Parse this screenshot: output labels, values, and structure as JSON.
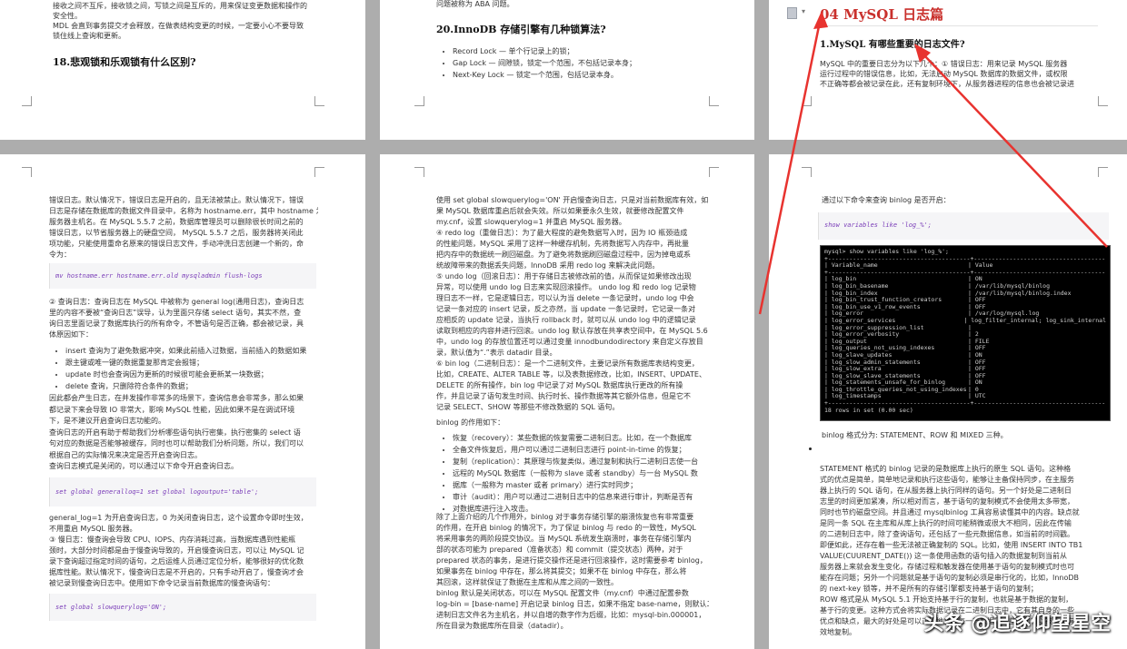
{
  "doc": {
    "p1": {
      "top_lines": [
        "接收之间不互斥，接收锁之间，写锁之间是互斥的，用来保证变更数据和操作的",
        "安全性。",
        "MDL 会直到事务提交才会释放，在做表结构变更的时候，一定要小心不要导致",
        "锁住线上查询和更新。"
      ],
      "heading": "18.悲观锁和乐观锁有什么区别?"
    },
    "p2": {
      "top_line": "问题被称为 ABA 问题。",
      "heading": "20.InnoDB 存储引擎有几种锁算法?",
      "bullets": [
        "Record Lock — 单个行记录上的锁；",
        "Gap Lock — 间隙锁，锁定一个范围，不包括记录本身；",
        "Next-Key Lock — 锁定一个范围，包括记录本身。"
      ]
    },
    "p3": {
      "title": "04 MySQL 日志篇",
      "heading": "1.MySQL 有哪些重要的日志文件?",
      "lines": [
        "MySQL 中的重要日志分为以下几个：① 错误日志：用来记录 MySQL 服务器",
        "运行过程中的错误信息，比如，无法启动 MySQL 数据库的数据文件，或权限",
        "不正确等都会被记录在此，还有复制环境下，从服务器进程的信息也会被记录进"
      ]
    },
    "p4": {
      "lines_a": [
        "错误日志。默认情况下，错误日志是开启的，且无法被禁止。默认情况下，错误",
        "日志是存储在数据库的数据文件目录中，名称为 hostname.err，其中 hostname 为",
        "服务器主机名。在 MySQL 5.5.7 之前，数据库管理员可以删除很长时间之前的",
        "错误日志，以节省服务器上的硬盘空间， MySQL 5.5.7 之后，服务器将关闭此",
        "项功能，只能使用重命名原来的错误日志文件，手动冲洗日志创建一个新的，命",
        "令为："
      ],
      "code1": "mv hostname.err  hostname.err.old mysqladmin flush-logs",
      "lines_b": [
        "② 查询日志：查询日志在 MySQL 中被称为 general log(通用日志)，查询日志",
        "里的内容不要被“查询日志”误导，认为里面只存储 select 语句，其实不然，查",
        "询日志里面记录了数据库执行的所有命令，不管语句是否正确，都会被记录，具",
        "体原因如下："
      ],
      "bullets": [
        "insert 查询为了避免数据冲突，如果此前插入过数据，当前插入的数据如果",
        "跟主键或唯一键的数据重复那肯定会报错；",
        "update 时也会查询因为更新的时候很可能会更新某一块数据；",
        "delete 查询，只删除符合条件的数据；"
      ],
      "lines_c": [
        "因此都会产生日志，在并发操作非常多的场景下，查询信息会非常多，那么如果",
        "都记录下来会导致 IO 非常大，影响 MySQL 性能，因此如果不是在调试环境",
        "下，是不建议开启查询日志功能的。",
        "查询日志的开启有助于帮助我们分析哪些语句执行密集，执行密集的 select 语",
        "句对应的数据是否能够被缓存，同时也可以帮助我们分析问题，所以，我们可以",
        "根据自己的实际情况来决定是否开启查询日志。",
        "查询日志模式是关闭的，可以通过以下命令开启查询日志。"
      ],
      "code2": "set global generalloq=1 set global logoutput='table';",
      "lines_d": [
        "general_log=1 为开启查询日志，0 为关闭查询日志，这个设置命令即时生效，",
        "不用重启 MySQL 服务器。",
        "③ 慢日志：慢查询会导致 CPU、IOPS、内存消耗过高，当数据库遇到性能瓶",
        "颈时，大部分时间都是由于慢查询导致的，开启慢查询日志，可以让 MySQL 记",
        "录下查询超过指定时间的语句，之后运维人员通过定位分析，能够很好的优化数",
        "据库性能。默认情况下，慢查询日志是不开启的，只有手动开启了，慢查询才会",
        "被记录到慢查询日志中。使用如下命令记录当前数据库的慢查询语句："
      ],
      "code3": "set global slowquerylog='ON';"
    },
    "p5": {
      "lines_a": [
        "使用 set global slowquerylog='ON' 开启慢查询日志，只是对当前数据库有效，如",
        "果 MySQL 数据库重启后就会失效。所以如果要永久生效，就要修改配置文件",
        "my.cnf，设置 slowquerylog=1 并重启 MySQL 服务器。",
        "④ redo log（重做日志）：为了最大程度的避免数据写入时，因为 IO 瓶颈造成",
        "的性能问题，MySQL 采用了这样一种缓存机制，先将数据写入内存中，再批量",
        "把内存中的数据统一刷回磁盘。为了避免将数据刷回磁盘过程中，因为掉电或系",
        "统故障带来的数据丢失问题，InnoDB 采用 redo log 来解决此问题。",
        "⑤ undo log（回滚日志）：用于存储日志被修改前的值，从而保证如果修改出现",
        "异常，可以使用 undo log 日志来实现回滚操作。 undo log 和 redo log 记录物",
        "理日志不一样，它是逻辑日志，可以认为当 delete 一条记录时，undo log 中会",
        "记录一条对应的 insert 记录，反之亦然，当 update 一条记录时，它记录一条对",
        "应相反的 update 记录，当执行 rollback 时，就可以从 undo log 中的逻辑记录",
        "读取到相应的内容并进行回滚。undo log 默认存放在共享表空间中，在 MySQL 5.6",
        "中，undo log 的存放位置还可以通过变量 innodbundodirectory 来自定义存放目",
        "录，默认值为“.”表示 datadir 目录。",
        "⑥ bin log（二进制日志）：是一个二进制文件，主要记录所有数据库表结构变更，",
        "比如，CREATE、ALTER TABLE 等，以及表数据修改，比如，INSERT、UPDATE、",
        "DELETE 的所有操作，bin log 中记录了对 MySQL 数据库执行更改的所有操",
        "作，并且记录了语句发生时间、执行时长、操作数据等其它额外信息，但是它不",
        "记录 SELECT、SHOW 等那些不修改数据的 SQL 语句。"
      ],
      "binlog_use": "binlog 的作用如下：",
      "bullets": [
        "恢复（recovery）：某些数据的恢复需要二进制日志。比如，在一个数据库",
        "全备文件恢复后，用户可以通过二进制日志进行 point-in-time 的恢复；",
        "复制（replication）：其原理与恢复类似，通过复制和执行二进制日志使一台",
        "远程的 MySQL 数据库（一般称为 slave 或者 standby）与一台 MySQL 数",
        "据库（一般称为 master 或者 primary）进行实时同步；",
        "审计（audit）：用户可以通过二进制日志中的信息来进行审计，判断是否有",
        "对数据库进行注入攻击。"
      ],
      "lines_b": [
        "除了上面介绍的几个作用外，binlog 对于事务存储引擎的崩溃恢复也有非常重要",
        "的作用，在开启 binlog 的情况下，为了保证 binlog 与 redo 的一致性，MySQL",
        "将采用事务的两阶段提交协议。当 MySQL 系统发生崩溃时，事务在存储引擎内",
        "部的状态可能为 prepared（准备状态）和 commit（提交状态）两种，对于",
        "prepared 状态的事务，是进行提交操作还是进行回滚操作，这时需要参考 binlog，",
        "如果事务在 binlog 中存在，那么将其提交；如果不在 binlog 中存在，那么将",
        "其回滚，这样就保证了数据在主库和从库之间的一致性。",
        "binlog 默认是关闭状态，可以在 MySQL 配置文件（my.cnf）中通过配置参数",
        "log-bin = [base-name] 开启记录 binlog 日志，如果不指定 base-name，则默认二",
        "进制日志文件名为主机名，并以自增的数字作为后缀，比如：mysql-bin.000001，",
        "所在目录为数据库所在目录（datadir）。"
      ]
    },
    "p6": {
      "intro": "通过以下命令来查询 binlog 是否开启：",
      "code": "show variables like 'log_%';",
      "terminal": {
        "prompt": "mysql> show variables like 'log_%';",
        "border": "+----------------------------------------+---------------------------------------+",
        "header": [
          "Variable_name",
          "Value"
        ],
        "rows": [
          [
            "log_bin",
            "ON"
          ],
          [
            "log_bin_basename",
            "/var/lib/mysql/binlog"
          ],
          [
            "log_bin_index",
            "/var/lib/mysql/binlog.index"
          ],
          [
            "log_bin_trust_function_creators",
            "OFF"
          ],
          [
            "log_bin_use_v1_row_events",
            "OFF"
          ],
          [
            "log_error",
            "/var/log/mysql.log"
          ],
          [
            "log_error_services",
            "log_filter_internal; log_sink_internal"
          ],
          [
            "log_error_suppression_list",
            ""
          ],
          [
            "log_error_verbosity",
            "2"
          ],
          [
            "log_output",
            "FILE"
          ],
          [
            "log_queries_not_using_indexes",
            "OFF"
          ],
          [
            "log_slave_updates",
            "ON"
          ],
          [
            "log_slow_admin_statements",
            "OFF"
          ],
          [
            "log_slow_extra",
            "OFF"
          ],
          [
            "log_slow_slave_statements",
            "OFF"
          ],
          [
            "log_statements_unsafe_for_binlog",
            "ON"
          ],
          [
            "log_throttle_queries_not_using_indexes",
            "0"
          ],
          [
            "log_timestamps",
            "UTC"
          ]
        ],
        "footer": "18 rows in set (0.00 sec)"
      },
      "format_line": "binlog 格式分为: STATEMENT、ROW 和 MIXED 三种。",
      "lines": [
        "STATEMENT 格式的 binlog 记录的是数据库上执行的原生 SQL 语句。这种格",
        "式的优点是简单，简单地记录和执行这些语句，能够让主备保持同步，在主服务",
        "器上执行的 SQL 语句，在从服务器上执行同样的语句。另一个好处是二进制日",
        "志里的时间更加紧凑，所以相对而言，基于语句的复制模式不会使用太多带宽，",
        "同时也节约磁盘空间。并且通过 mysqlbinlog 工具容易读懂其中的内容。缺点就",
        "是同一条 SQL 在主库和从库上执行的时间可能稍微或很大不相同，因此在传输",
        "的二进制日志中，除了查询语句，还包括了一些元数据信息，如当前的时间戳。",
        "即便如此，还存在着一些无法被正确复制的 SQL。比如，使用 INSERT INTO TB1",
        "VALUE(CUURENT_DATE()) 这一条使用函数的语句插入的数据复制到当前从",
        "服务器上来就会发生变化，存储过程和触发器在使用基于语句的复制模式时也可",
        "能存在问题；另外一个问题就是基于语句的复制必须是串行化的，比如，InnoDB",
        "的 next-key 锁等，并不是所有的存储引擎都支持基于语句的复制；",
        "ROW 格式是从 MySQL 5.1 开始支持基于行的复制，也就是基于数据的复制，",
        "基于行的变更。这种方式会将实际数据记录在二进制日志中，它有其自身的一些",
        "优点和缺点，最大的好处是可以正确地复制每一行数据，一些语句可以被更加有",
        "效地复制。"
      ]
    },
    "toolbar_icon": "document-icon",
    "watermark": "头条 @追逐仰望星空",
    "arrow_color": "#e8332f"
  }
}
